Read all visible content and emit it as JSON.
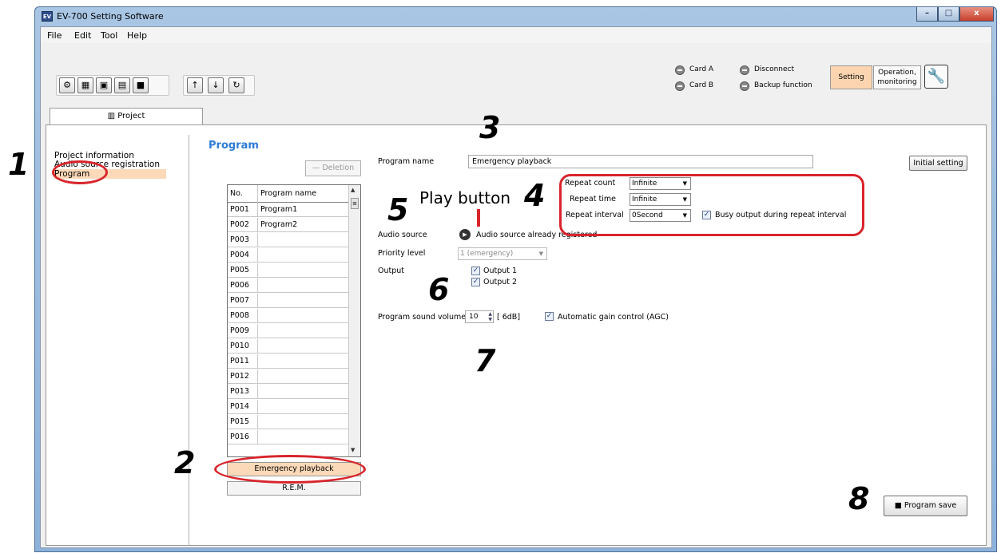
{
  "window": {
    "title": "EV-700 Setting Software",
    "icon_text": "EV",
    "controls": {
      "minimize": "–",
      "maximize": "□",
      "close": "x"
    }
  },
  "menu": [
    "File",
    "Edit",
    "Tool",
    "Help"
  ],
  "toolbar": {
    "group1_icons": [
      "new-project-icon",
      "add-program-icon",
      "settings-file-icon",
      "open-program-icon",
      "save-icon"
    ],
    "group2_icons": [
      "upload-icon",
      "download-icon",
      "sync-icon"
    ]
  },
  "status": {
    "card_a": "Card A",
    "card_b": "Card B",
    "disconnect": "Disconnect",
    "backup": "Backup function"
  },
  "mode_buttons": {
    "setting": "Setting",
    "operation_line1": "Operation,",
    "operation_line2": "monitoring",
    "setting_active_color": "#fcd5b0"
  },
  "project_tab": "Project",
  "nav": {
    "items": [
      "Project information",
      "Audio source registration",
      "Program"
    ],
    "selected": "Program"
  },
  "program_panel": {
    "heading": "Program",
    "deletion_label": "Deletion",
    "columns": [
      "No.",
      "Program name"
    ],
    "rows": [
      {
        "no": "P001",
        "name": "Program1"
      },
      {
        "no": "P002",
        "name": "Program2"
      },
      {
        "no": "P003",
        "name": ""
      },
      {
        "no": "P004",
        "name": ""
      },
      {
        "no": "P005",
        "name": ""
      },
      {
        "no": "P006",
        "name": ""
      },
      {
        "no": "P007",
        "name": ""
      },
      {
        "no": "P008",
        "name": ""
      },
      {
        "no": "P009",
        "name": ""
      },
      {
        "no": "P010",
        "name": ""
      },
      {
        "no": "P011",
        "name": ""
      },
      {
        "no": "P012",
        "name": ""
      },
      {
        "no": "P013",
        "name": ""
      },
      {
        "no": "P014",
        "name": ""
      },
      {
        "no": "P015",
        "name": ""
      },
      {
        "no": "P016",
        "name": ""
      }
    ],
    "emergency_button": "Emergency playback",
    "rem_button": "R.E.M."
  },
  "detail": {
    "program_name_label": "Program name",
    "program_name_value": "Emergency playback",
    "initial_setting_button": "Initial setting",
    "repeat_count_label": "Repeat count",
    "repeat_count_value": "Infinite",
    "repeat_time_label": "Repeat time",
    "repeat_time_value": "Infinite",
    "repeat_interval_label": "Repeat interval",
    "repeat_interval_value": "0Second",
    "busy_output_label": "Busy output during repeat interval",
    "audio_source_label": "Audio source",
    "audio_source_status": "Audio source already registered",
    "priority_label": "Priority level",
    "priority_value": "1 (emergency)",
    "output_label": "Output",
    "output_1": "Output 1",
    "output_2": "Output 2",
    "volume_label": "Program sound volume",
    "volume_value": "10",
    "volume_db": "[   6dB]",
    "agc_label": "Automatic gain control (AGC)",
    "save_button": "Program save"
  },
  "annotations": {
    "n1": "1",
    "n2": "2",
    "n3": "3",
    "n4": "4",
    "n5": "5",
    "n6": "6",
    "n7": "7",
    "n8": "8",
    "play_button_label": "Play button",
    "highlight_color": "#d8242b"
  }
}
